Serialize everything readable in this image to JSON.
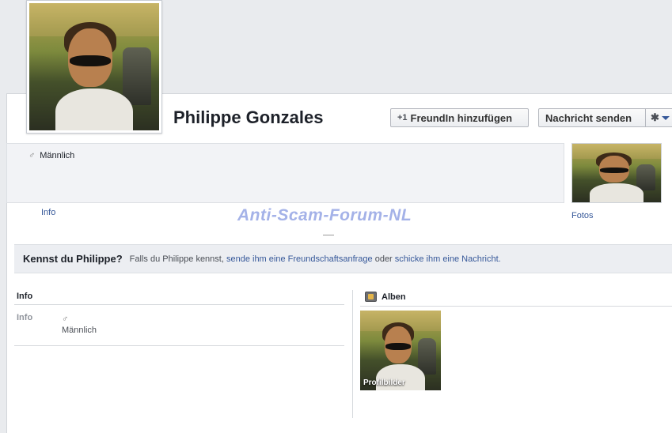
{
  "profile": {
    "name": "Philippe Gonzales",
    "gender": "Männlich",
    "gender_symbol": "♂"
  },
  "actions": {
    "add_friend_icon": "+1",
    "add_friend": "FreundIn hinzufügen",
    "send_message": "Nachricht senden",
    "gear_symbol": "✱"
  },
  "tabs": {
    "info": "Info",
    "photos": "Fotos"
  },
  "watermark": "Anti-Scam-Forum-NL",
  "know": {
    "title": "Kennst du Philippe?",
    "text_1": "Falls du Philippe kennst,",
    "link_request": "sende ihm eine Freundschaftsanfrage",
    "text_2": "oder",
    "link_message": "schicke ihm eine Nachricht."
  },
  "info_section": {
    "title": "Info",
    "row_label": "Info",
    "row_symbol": "♂",
    "row_value": "Männlich"
  },
  "albums": {
    "title": "Alben",
    "album_caption": "Profilbilder"
  },
  "icons": {
    "add_friend": "add-friend-icon",
    "gear": "gear-icon",
    "dropdown": "chevron-down-icon",
    "gender": "male-icon",
    "album": "photo-album-icon"
  }
}
